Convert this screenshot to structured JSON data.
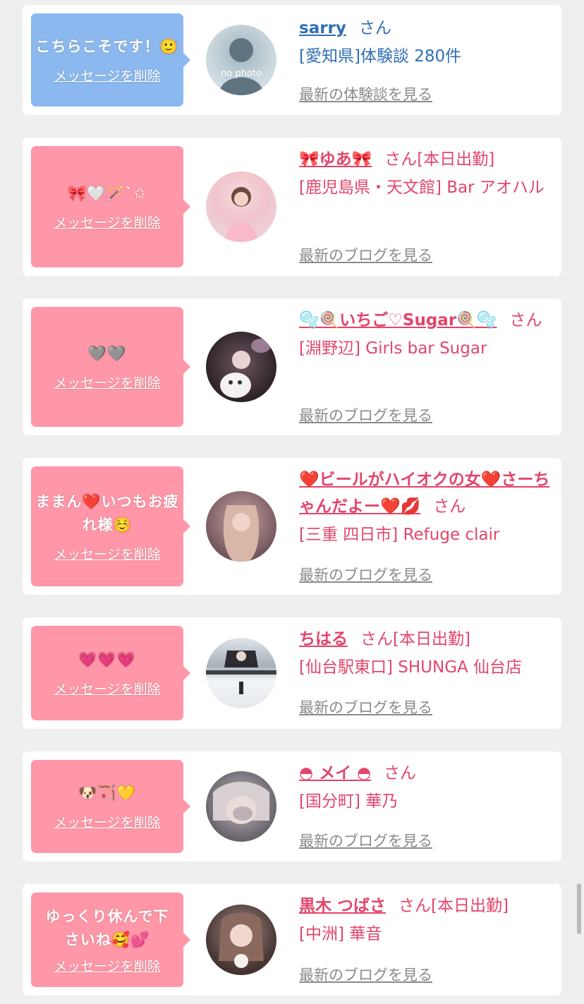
{
  "delete_label": "メッセージを削除",
  "san": "さん",
  "entries": [
    {
      "message": "こちらこそです！🙂",
      "name": "sarry",
      "suffix": "",
      "shop": "[愛知県]体験談 280件",
      "latest": "最新の体験談を見る",
      "avatar_text": "no photo",
      "theme": "blue"
    },
    {
      "message": "🎀🤍🪄ˋ✩",
      "name": "🎀ゆあ🎀",
      "suffix": "[本日出勤]",
      "shop": "[鹿児島県・天文館] Bar アオハル",
      "latest": "最新のブログを見る",
      "theme": "pink"
    },
    {
      "message": "🩶🩶",
      "name": "🫧🍭いちご♡Sugar🍭🫧",
      "suffix": "",
      "shop": "[淵野辺] Girls bar Sugar",
      "latest": "最新のブログを見る",
      "theme": "pink"
    },
    {
      "message": "ままん❤️いつもお疲れ様☺️",
      "name": "❤️ビールがハイオクの女❤️さーちゃんだよー❤️💋",
      "suffix": "",
      "shop": "[三重 四日市] Refuge clair",
      "latest": "最新のブログを見る",
      "theme": "pink"
    },
    {
      "message": "💗💗💗",
      "name": "ちはる",
      "suffix": "[本日出勤]",
      "shop": "[仙台駅東口] SHUNGA 仙台店",
      "latest": "最新のブログを見る",
      "theme": "pink"
    },
    {
      "message": "🐶🏹💛",
      "name": "◓ メイ ◓",
      "suffix": "",
      "shop": "[国分町] 華乃",
      "latest": "最新のブログを見る",
      "theme": "pink"
    },
    {
      "message": "ゆっくり休んで下さいね🥰💕",
      "name": "黒木 つばさ",
      "suffix": "[本日出勤]",
      "shop": "[中洲] 華音",
      "latest": "最新のブログを見る",
      "theme": "pink"
    }
  ]
}
